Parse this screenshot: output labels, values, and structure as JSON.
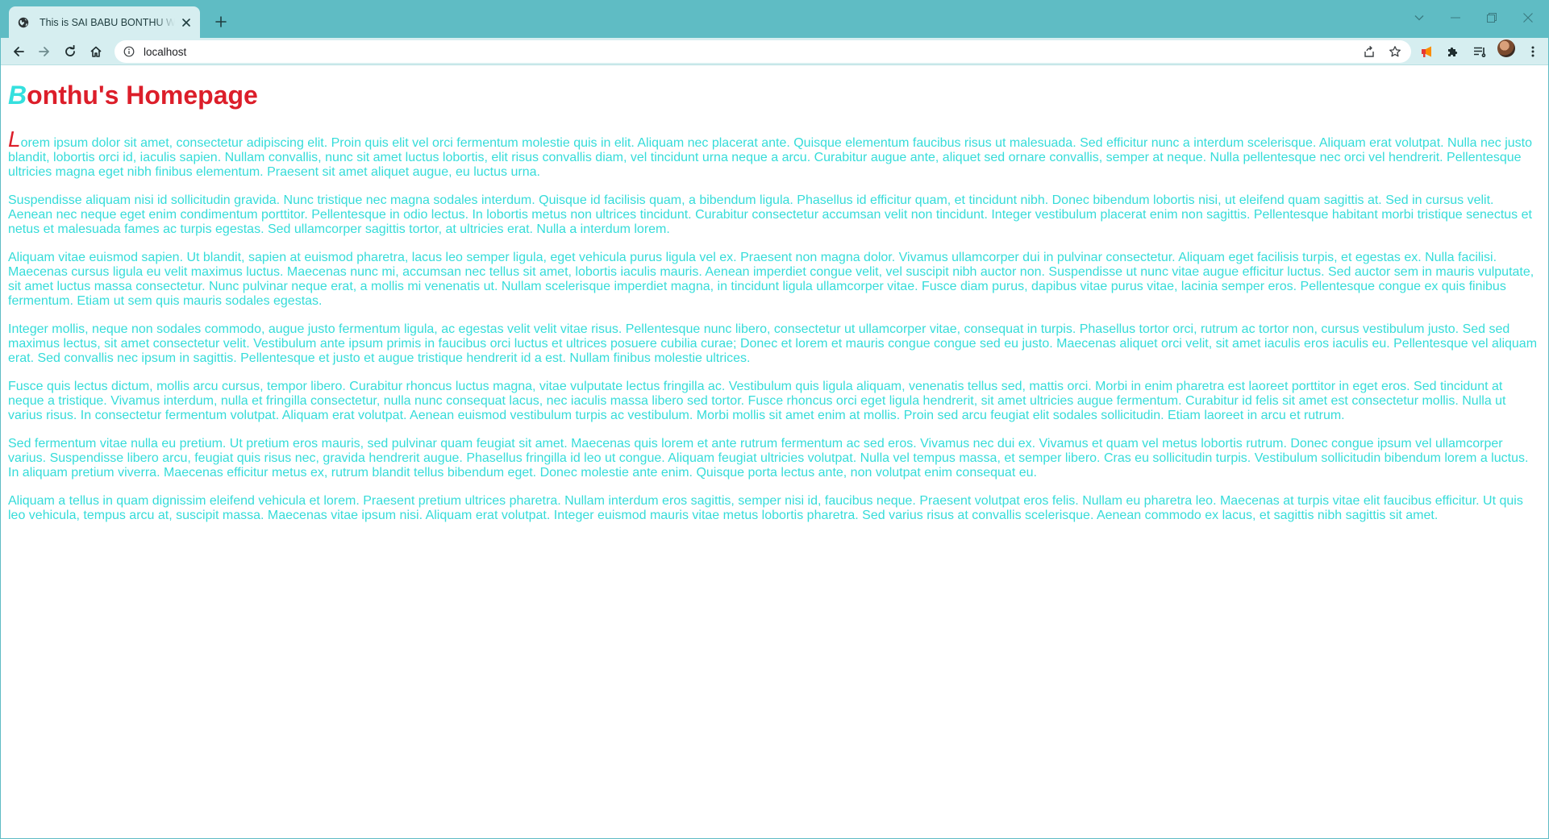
{
  "browser": {
    "tab": {
      "title": "This is SAI BABU BONTHU Website",
      "favicon": "globe-icon"
    },
    "address_bar": {
      "url": "localhost"
    },
    "colors": {
      "frame": "#5fbcc4",
      "toolbar": "#d6eef0"
    }
  },
  "page": {
    "title_first_letter": "B",
    "title_rest": "onthu's Homepage",
    "colors": {
      "title": "#dc1e2a",
      "accent": "#35e0de",
      "body_text": "#35dcd9"
    },
    "first_paragraph_dropcap": "L",
    "first_paragraph_rest": "orem ipsum dolor sit amet, consectetur adipiscing elit. Proin quis elit vel orci fermentum molestie quis in elit. Aliquam nec placerat ante. Quisque elementum faucibus risus ut malesuada. Sed efficitur nunc a interdum scelerisque. Aliquam erat volutpat. Nulla nec justo blandit, lobortis orci id, iaculis sapien. Nullam convallis, nunc sit amet luctus lobortis, elit risus convallis diam, vel tincidunt urna neque a arcu. Curabitur augue ante, aliquet sed ornare convallis, semper at neque. Nulla pellentesque nec orci vel hendrerit. Pellentesque ultricies magna eget nibh finibus elementum. Praesent sit amet aliquet augue, eu luctus urna.",
    "paragraphs": [
      "Suspendisse aliquam nisi id sollicitudin gravida. Nunc tristique nec magna sodales interdum. Quisque id facilisis quam, a bibendum ligula. Phasellus id efficitur quam, et tincidunt nibh. Donec bibendum lobortis nisi, ut eleifend quam sagittis at. Sed in cursus velit. Aenean nec neque eget enim condimentum porttitor. Pellentesque in odio lectus. In lobortis metus non ultrices tincidunt. Curabitur consectetur accumsan velit non tincidunt. Integer vestibulum placerat enim non sagittis. Pellentesque habitant morbi tristique senectus et netus et malesuada fames ac turpis egestas. Sed ullamcorper sagittis tortor, at ultricies erat. Nulla a interdum lorem.",
      "Aliquam vitae euismod sapien. Ut blandit, sapien at euismod pharetra, lacus leo semper ligula, eget vehicula purus ligula vel ex. Praesent non magna dolor. Vivamus ullamcorper dui in pulvinar consectetur. Aliquam eget facilisis turpis, et egestas ex. Nulla facilisi. Maecenas cursus ligula eu velit maximus luctus. Maecenas nunc mi, accumsan nec tellus sit amet, lobortis iaculis mauris. Aenean imperdiet congue velit, vel suscipit nibh auctor non. Suspendisse ut nunc vitae augue efficitur luctus. Sed auctor sem in mauris vulputate, sit amet luctus massa consectetur. Nunc pulvinar neque erat, a mollis mi venenatis ut. Nullam scelerisque imperdiet magna, in tincidunt ligula ullamcorper vitae. Fusce diam purus, dapibus vitae purus vitae, lacinia semper eros. Pellentesque congue ex quis finibus fermentum. Etiam ut sem quis mauris sodales egestas.",
      "Integer mollis, neque non sodales commodo, augue justo fermentum ligula, ac egestas velit velit vitae risus. Pellentesque nunc libero, consectetur ut ullamcorper vitae, consequat in turpis. Phasellus tortor orci, rutrum ac tortor non, cursus vestibulum justo. Sed sed maximus lectus, sit amet consectetur velit. Vestibulum ante ipsum primis in faucibus orci luctus et ultrices posuere cubilia curae; Donec et lorem et mauris congue congue sed eu justo. Maecenas aliquet orci velit, sit amet iaculis eros iaculis eu. Pellentesque vel aliquam erat. Sed convallis nec ipsum in sagittis. Pellentesque et justo et augue tristique hendrerit id a est. Nullam finibus molestie ultrices.",
      "Fusce quis lectus dictum, mollis arcu cursus, tempor libero. Curabitur rhoncus luctus magna, vitae vulputate lectus fringilla ac. Vestibulum quis ligula aliquam, venenatis tellus sed, mattis orci. Morbi in enim pharetra est laoreet porttitor in eget eros. Sed tincidunt at neque a tristique. Vivamus interdum, nulla et fringilla consectetur, nulla nunc consequat lacus, nec iaculis massa libero sed tortor. Fusce rhoncus orci eget ligula hendrerit, sit amet ultricies augue fermentum. Curabitur id felis sit amet est consectetur mollis. Nulla ut varius risus. In consectetur fermentum volutpat. Aliquam erat volutpat. Aenean euismod vestibulum turpis ac vestibulum. Morbi mollis sit amet enim at mollis. Proin sed arcu feugiat elit sodales sollicitudin. Etiam laoreet in arcu et rutrum.",
      "Sed fermentum vitae nulla eu pretium. Ut pretium eros mauris, sed pulvinar quam feugiat sit amet. Maecenas quis lorem et ante rutrum fermentum ac sed eros. Vivamus nec dui ex. Vivamus et quam vel metus lobortis rutrum. Donec congue ipsum vel ullamcorper varius. Suspendisse libero arcu, feugiat quis risus nec, gravida hendrerit augue. Phasellus fringilla id leo ut congue. Aliquam feugiat ultricies volutpat. Nulla vel tempus massa, et semper libero. Cras eu sollicitudin turpis. Vestibulum sollicitudin bibendum lorem a luctus. In aliquam pretium viverra. Maecenas efficitur metus ex, rutrum blandit tellus bibendum eget. Donec molestie ante enim. Quisque porta lectus ante, non volutpat enim consequat eu.",
      "Aliquam a tellus in quam dignissim eleifend vehicula et lorem. Praesent pretium ultrices pharetra. Nullam interdum eros sagittis, semper nisi id, faucibus neque. Praesent volutpat eros felis. Nullam eu pharetra leo. Maecenas at turpis vitae elit faucibus efficitur. Ut quis leo vehicula, tempus arcu at, suscipit massa. Maecenas vitae ipsum nisi. Aliquam erat volutpat. Integer euismod mauris vitae metus lobortis pharetra. Sed varius risus at convallis scelerisque. Aenean commodo ex lacus, et sagittis nibh sagittis sit amet."
    ]
  }
}
